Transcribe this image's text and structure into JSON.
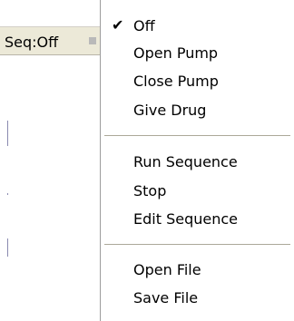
{
  "toolbar": {
    "seq_label": "Seq:Off"
  },
  "menu": {
    "items": [
      {
        "label": "Off",
        "checked": true,
        "check_glyph": "✔"
      },
      {
        "label": "Open Pump",
        "checked": false
      },
      {
        "label": "Close Pump",
        "checked": false
      },
      {
        "label": "Give Drug",
        "checked": false
      },
      {
        "label": "Run Sequence",
        "checked": false
      },
      {
        "label": "Stop",
        "checked": false
      },
      {
        "label": "Edit Sequence",
        "checked": false
      },
      {
        "label": "Open File",
        "checked": false
      },
      {
        "label": "Save File",
        "checked": false
      }
    ]
  },
  "icons": {
    "check": "checkmark-icon",
    "dropdown": "dropdown-arrow-icon"
  }
}
